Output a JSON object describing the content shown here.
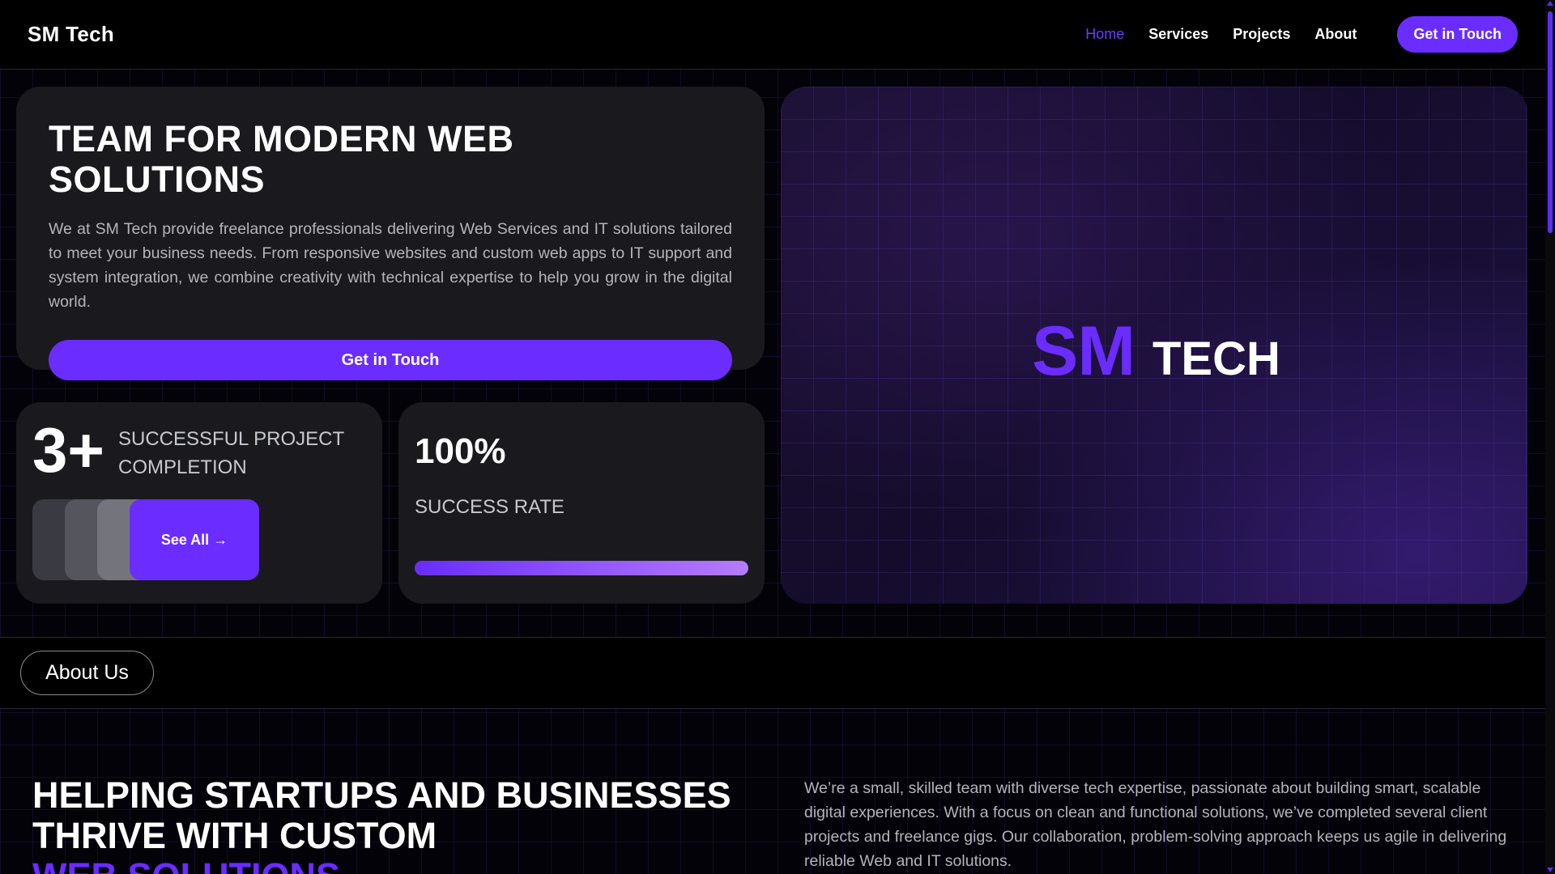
{
  "header": {
    "brand": "SM Tech",
    "nav": [
      "Home",
      "Services",
      "Projects",
      "About"
    ],
    "cta": "Get in Touch"
  },
  "hero": {
    "title": "TEAM FOR MODERN WEB SOLUTIONS",
    "text": "We at SM Tech provide freelance professionals delivering Web Services and IT solutions tailored to meet your business needs. From responsive websites and custom web apps to IT support and system integration, we combine creativity with technical expertise to help you grow in the digital world.",
    "button": "Get in Touch"
  },
  "stats": {
    "projects_number": "3+",
    "projects_label": "SUCCESSFUL PROJECT COMPLETION",
    "see_all": "See All →",
    "rate_value": "100%",
    "rate_label": "SUCCESS RATE",
    "rate_fraction": 1.0
  },
  "visual": {
    "logo_sm": "SM",
    "logo_tech": "TECH"
  },
  "about": {
    "pill": "About Us",
    "heading_line1": "HELPING STARTUPS AND BUSINESSES",
    "heading_line2": "THRIVE WITH CUSTOM",
    "heading_line3": "WEB SOLUTIONS",
    "text": "We’re a small, skilled team with diverse tech expertise, passionate about building smart, scalable digital experiences. With a focus on clean and functional solutions, we’ve completed several client projects and freelance gigs. Our collaboration, problem-solving approach keeps us agile in delivering reliable Web and IT solutions."
  },
  "colors": {
    "accent": "#6a2cff",
    "card": "#1a1a1e",
    "background": "#000000"
  }
}
